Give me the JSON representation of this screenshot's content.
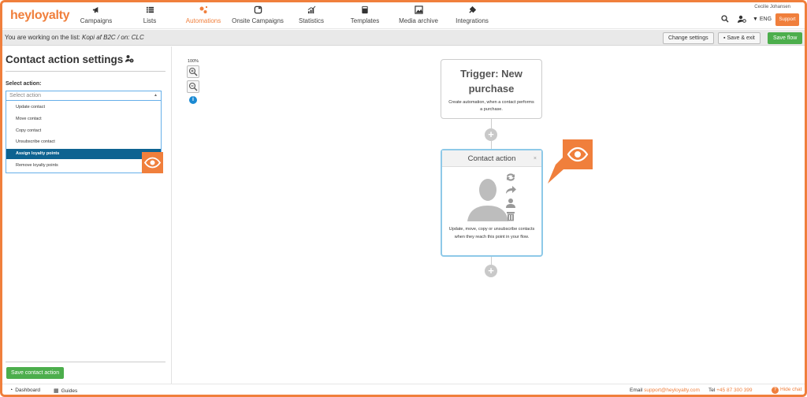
{
  "app": {
    "logo_text_a": "hey",
    "logo_text_b": "loyalty",
    "user_name": "Cecilie Johansen",
    "lang": "ENG",
    "support_label": "Support"
  },
  "nav": [
    {
      "label": "Campaigns",
      "icon": "megaphone-icon"
    },
    {
      "label": "Lists",
      "icon": "list-icon"
    },
    {
      "label": "Automations",
      "icon": "automation-icon",
      "active": true
    },
    {
      "label": "Onsite Campaigns",
      "icon": "window-icon"
    },
    {
      "label": "Statistics",
      "icon": "chart-icon"
    },
    {
      "label": "Templates",
      "icon": "calculator-icon"
    },
    {
      "label": "Media archive",
      "icon": "image-icon"
    },
    {
      "label": "Integrations",
      "icon": "plug-icon"
    }
  ],
  "listbar": {
    "prefix": "You are working on the list:",
    "list_name": "Kopi af B2C",
    "on_label": "/ on: CLC",
    "change_settings": "Change settings",
    "save_exit": "Save & exit",
    "save_flow": "Save flow"
  },
  "panel": {
    "title": "Contact action settings",
    "select_label": "Select action:",
    "select_placeholder": "Select action",
    "options": [
      "Update contact",
      "Move contact",
      "Copy contact",
      "Unsubscribe contact",
      "Assign loyalty points",
      "Remove loyalty points"
    ],
    "selected_index": 4,
    "save_button": "Save contact action"
  },
  "canvas": {
    "zoom": "100%",
    "info": "i",
    "trigger_title": "Trigger: New purchase",
    "trigger_desc": "Create automation, when a contact performs a purchase.",
    "action_title": "Contact action",
    "action_close": "×",
    "action_desc": "Update, move, copy or unsubscribe contacts when they reach this point in your flow."
  },
  "footer": {
    "dashboard": "Dashboard",
    "guides": "Guides",
    "email_label": "Email",
    "email": "support@heyloyalty.com",
    "tel_label": "Tel",
    "tel": "+45 87 300 399",
    "hide_chat": "Hide chat"
  },
  "colors": {
    "accent": "#f07f3c",
    "green": "#4cae4c",
    "selected": "#0e6391",
    "card_border": "#8ec9e8"
  }
}
